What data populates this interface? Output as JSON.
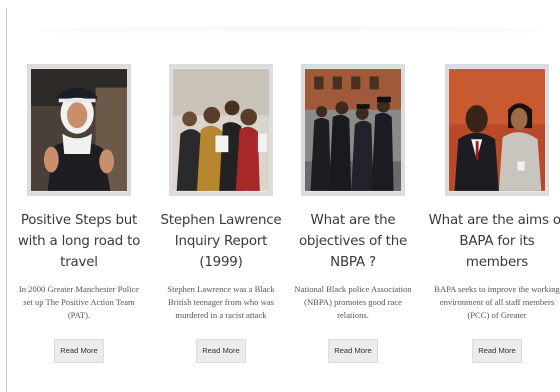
{
  "cards": [
    {
      "title": "Positive Steps but with a long road to travel",
      "excerpt": "In 2000 Greater Manchester Police set up The Positive Action Team (PAT).",
      "button_label": "Read More"
    },
    {
      "title": "Stephen Lawrence Inquiry Report (1999)",
      "excerpt": "Stephen Lawrence was a Black British teenager from who was murdered in a racist attack",
      "button_label": "Read More"
    },
    {
      "title": "What are the objectives of the NBPA ?",
      "excerpt": "National Black police Association (NBPA) promotes good race relations.",
      "button_label": "Read More"
    },
    {
      "title": "What are the aims of BAPA for its members",
      "excerpt": "BAPA seeks to improve the working environment of all staff members (PCC) of Greater",
      "button_label": "Read More"
    }
  ]
}
